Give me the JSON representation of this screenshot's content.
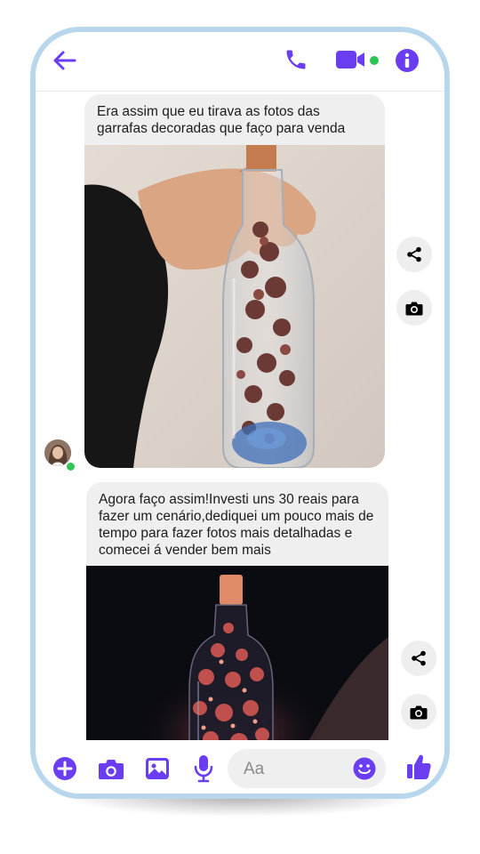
{
  "theme": {
    "accent": "#6a3df0",
    "online": "#30c452",
    "bubble": "#efefef",
    "frame": "#b9d7ec"
  },
  "header": {
    "icons": [
      "back-arrow-icon",
      "phone-call-icon",
      "video-call-icon",
      "info-icon"
    ]
  },
  "messages": [
    {
      "text": "Era assim que eu tirava as fotos das garrafas decoradas que faço para venda",
      "image": "hand-holding-decorated-bottle-photo"
    },
    {
      "text": "Agora faço assim!Investi uns 30 reais para fazer um cenário,dediquei um pouco mais de tempo para fazer fotos mais detalhadas e comecei á vender bem mais",
      "image": "lit-bottle-dark-background-photo"
    }
  ],
  "side_actions": [
    "share-icon",
    "camera-icon"
  ],
  "composer": {
    "placeholder": "Aa",
    "icons": [
      "plus-icon",
      "camera-icon",
      "gallery-icon",
      "microphone-icon",
      "emoji-icon",
      "thumbs-up-icon"
    ]
  }
}
